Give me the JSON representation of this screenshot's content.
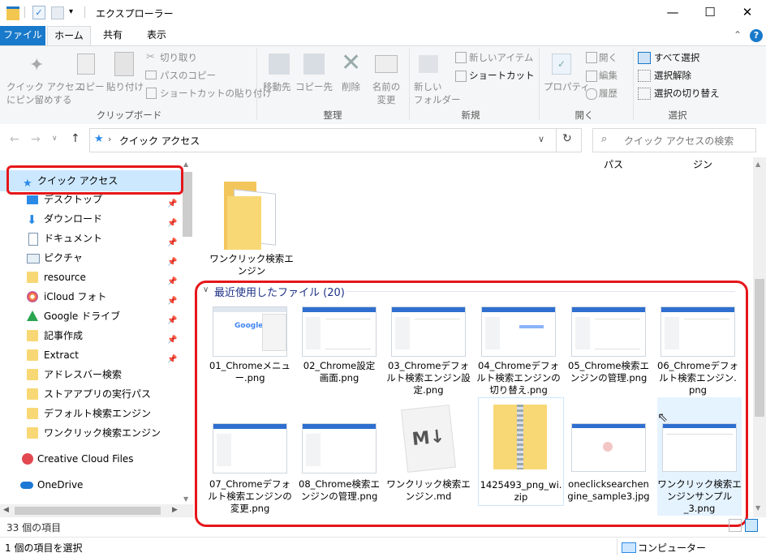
{
  "window": {
    "title": "エクスプローラー",
    "minimize": "—",
    "maximize": "☐",
    "close": "✕"
  },
  "tabs": [
    "ファイル",
    "ホーム",
    "共有",
    "表示"
  ],
  "ribbon": {
    "clipboard": {
      "pin_label1": "クイック アクセス",
      "pin_label2": "にピン留めする",
      "copy": "コピー",
      "paste": "貼り付け",
      "cut": "切り取り",
      "copy_path": "パスのコピー",
      "paste_shortcut": "ショートカットの貼り付け",
      "group": "クリップボード"
    },
    "organize": {
      "move_to": "移動先",
      "copy_to": "コピー先",
      "delete": "削除",
      "rename1": "名前の",
      "rename2": "変更",
      "group": "整理"
    },
    "new": {
      "new_folder1": "新しい",
      "new_folder2": "フォルダー",
      "new_item": "新しいアイテム",
      "shortcut": "ショートカット",
      "group": "新規"
    },
    "open": {
      "properties": "プロパティ",
      "open": "開く",
      "edit": "編集",
      "history": "履歴",
      "group": "開く"
    },
    "select": {
      "select_all": "すべて選択",
      "select_none": "選択解除",
      "invert": "選択の切り替え",
      "group": "選択"
    }
  },
  "address": {
    "path": "クイック アクセス",
    "search_placeholder": "クイック アクセスの検索"
  },
  "header_partial": {
    "left": "パス",
    "right": "ジン"
  },
  "nav": {
    "quick_access": "クイック アクセス",
    "items": [
      {
        "label": "デスクトップ",
        "pinned": true
      },
      {
        "label": "ダウンロード",
        "pinned": true
      },
      {
        "label": "ドキュメント",
        "pinned": true
      },
      {
        "label": "ピクチャ",
        "pinned": true
      },
      {
        "label": "resource",
        "pinned": true
      },
      {
        "label": "iCloud フォト",
        "pinned": true
      },
      {
        "label": "Google ドライブ",
        "pinned": true
      },
      {
        "label": "記事作成",
        "pinned": true
      },
      {
        "label": "Extract",
        "pinned": true
      },
      {
        "label": "アドレスバー検索",
        "pinned": false
      },
      {
        "label": "ストアアプリの実行パス",
        "pinned": false
      },
      {
        "label": "デフォルト検索エンジン",
        "pinned": false
      },
      {
        "label": "ワンクリック検索エンジン",
        "pinned": false
      }
    ],
    "creative_cloud": "Creative Cloud Files",
    "onedrive": "OneDrive"
  },
  "folder": {
    "line1": "ワンクリック検索エ",
    "line2": "ンジン"
  },
  "recent": {
    "header": "最近使用したファイル (20)",
    "files": [
      {
        "l1": "01_Chromeメニュ",
        "l2": "ー.png",
        "l3": ""
      },
      {
        "l1": "02_Chrome設定",
        "l2": "画面.png",
        "l3": ""
      },
      {
        "l1": "03_Chromeデフォ",
        "l2": "ルト検索エンジン設",
        "l3": "定.png"
      },
      {
        "l1": "04_Chromeデフォ",
        "l2": "ルト検索エンジンの",
        "l3": "切り替え.png"
      },
      {
        "l1": "05_Chrome検索エ",
        "l2": "ンジンの管理.png",
        "l3": ""
      },
      {
        "l1": "06_Chromeデフォ",
        "l2": "ルト検索エンジン.",
        "l3": "png"
      },
      {
        "l1": "07_Chromeデフォ",
        "l2": "ルト検索エンジンの",
        "l3": "変更.png"
      },
      {
        "l1": "08_Chrome検索エ",
        "l2": "ンジンの管理.png",
        "l3": ""
      },
      {
        "l1": "ワンクリック検索エ",
        "l2": "ンジン.md",
        "l3": ""
      },
      {
        "l1": "1425493_png_wi.",
        "l2": "zip",
        "l3": ""
      },
      {
        "l1": "oneclicksearchen",
        "l2": "gine_sample3.jpg",
        "l3": ""
      },
      {
        "l1": "ワンクリック検索エ",
        "l2": "ンジンサンプル",
        "l3": "_3.png"
      }
    ]
  },
  "status": {
    "count": "33 個の項目",
    "selected": "1 個の項目を選択",
    "computer": "コンピューター"
  },
  "colors": {
    "accent": "#1979ca",
    "highlight": "#e5161a",
    "folder": "#f8d775"
  }
}
